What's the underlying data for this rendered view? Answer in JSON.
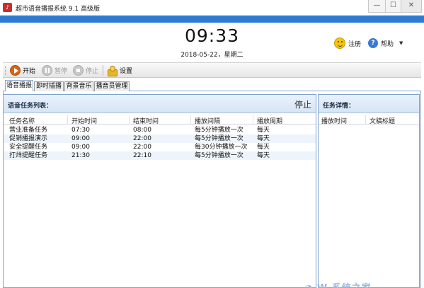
{
  "window": {
    "title": "超市语音播报系统 9.1 高级版",
    "minimize_icon": "—",
    "maximize_icon": "☐",
    "close_icon": "✕",
    "app_icon_glyph": "♪"
  },
  "header": {
    "time": "09:33",
    "date": "2018-05-22，星期二",
    "register_label": "注册",
    "help_label": "帮助",
    "help_icon_glyph": "?",
    "dropdown_glyph": "▼"
  },
  "toolbar": {
    "start_label": "开始",
    "pause_label": "暂停",
    "stop_label": "停止",
    "settings_label": "设置"
  },
  "tabs": [
    {
      "label": "语音播报",
      "active": true
    },
    {
      "label": "即时插播",
      "active": false
    },
    {
      "label": "背景音乐",
      "active": false
    },
    {
      "label": "播音员管理",
      "active": false
    }
  ],
  "task_list": {
    "title": "语音任务列表：",
    "status": "停止",
    "columns": [
      "任务名称",
      "开始时间",
      "结束时间",
      "播放间隔",
      "播放周期"
    ],
    "rows": [
      [
        "营业准备任务",
        "07:30",
        "08:00",
        "每5分钟播放一次",
        "每天"
      ],
      [
        "促销播报演示",
        "09:00",
        "22:00",
        "每5分钟播放一次",
        "每天"
      ],
      [
        "安全提醒任务",
        "09:00",
        "22:00",
        "每30分钟播放一次",
        "每天"
      ],
      [
        "打烊提醒任务",
        "21:30",
        "22:10",
        "每5分钟播放一次",
        "每天"
      ]
    ]
  },
  "task_detail": {
    "title": "任务详情：",
    "columns": [
      "播放时间",
      "文稿标题"
    ]
  },
  "watermark": "◔ W  系统之家",
  "colors": {
    "accent_blue": "#2f7bd4",
    "start_orange": "#d86414",
    "row_alt": "#eef4fb"
  }
}
